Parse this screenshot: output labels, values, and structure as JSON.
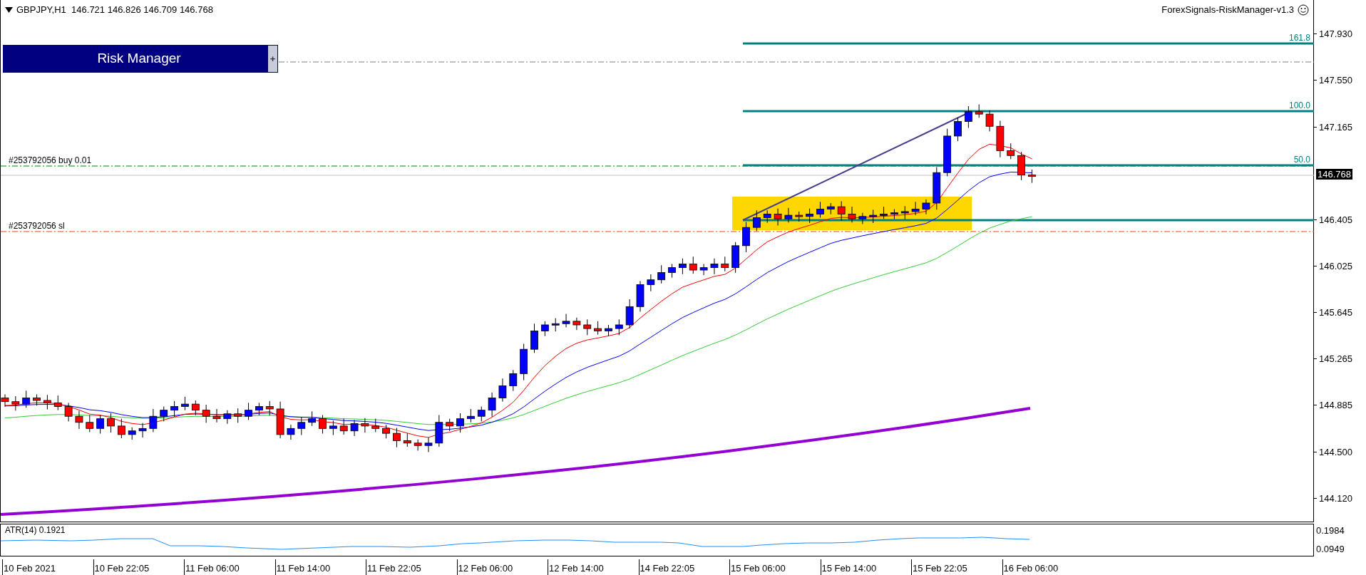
{
  "chart_header": {
    "symbol_prices": "GBPJPY,H1  146.721 146.826 146.709 146.768"
  },
  "risk_manager": {
    "title": "Risk Manager",
    "toggle": "+"
  },
  "indicator_label": "ForexSignals-RiskManager-v1.3",
  "fib_levels": [
    {
      "label": "161.8"
    },
    {
      "label": "100.0"
    },
    {
      "label": "50.0"
    }
  ],
  "order_lines": [
    {
      "label": "#253792056 buy 0.01",
      "kind": "entry"
    },
    {
      "label": "#253792056 sl",
      "kind": "stop"
    }
  ],
  "price_axis": {
    "ticks": [
      "147.930",
      "147.550",
      "147.165",
      "146.405",
      "146.025",
      "145.645",
      "145.265",
      "144.885",
      "144.500",
      "144.120"
    ],
    "current_price": "146.768"
  },
  "atr": {
    "label": "ATR(14) 0.1921",
    "ticks": [
      "0.1984",
      "0.0949"
    ]
  },
  "time_axis": [
    "10 Feb 2021",
    "10 Feb 22:05",
    "11 Feb 06:00",
    "11 Feb 14:00",
    "11 Feb 22:05",
    "12 Feb 06:00",
    "12 Feb 14:00",
    "14 Feb 22:05",
    "15 Feb 06:00",
    "15 Feb 14:00",
    "15 Feb 22:05",
    "16 Feb 06:00"
  ]
}
